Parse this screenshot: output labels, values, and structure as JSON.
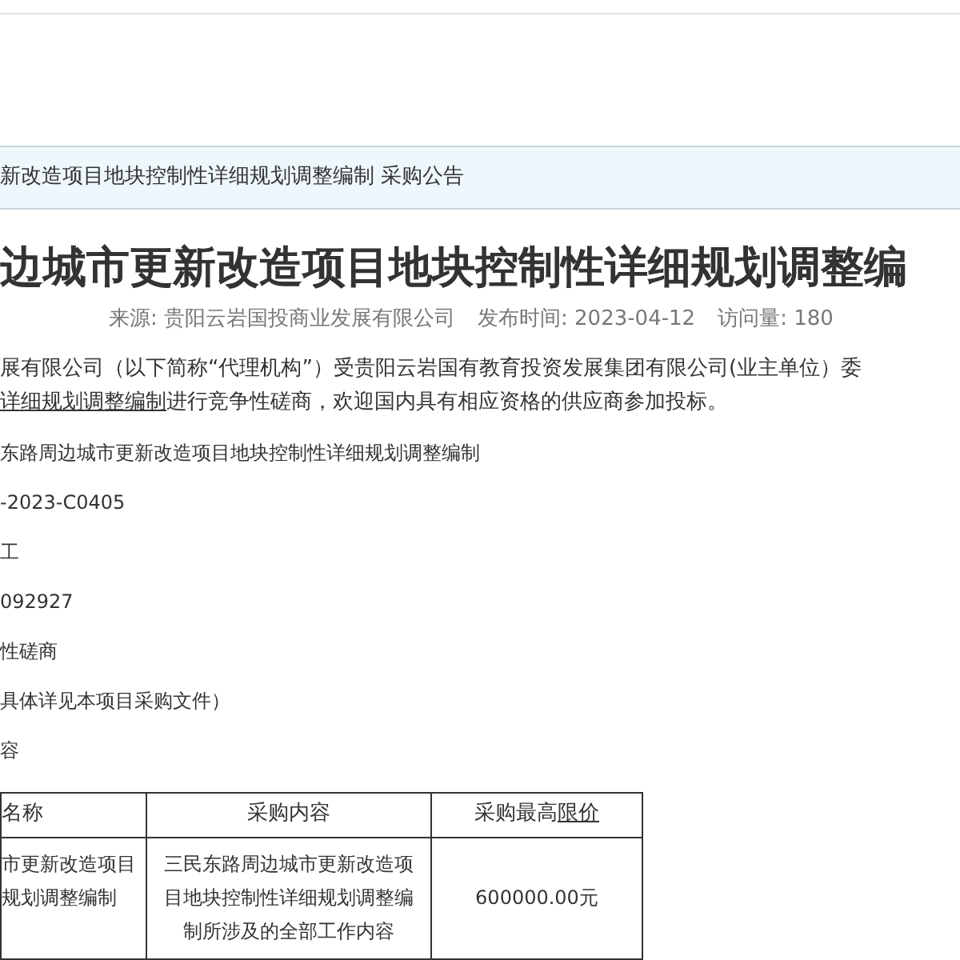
{
  "breadcrumb": "新改造项目地块控制性详细规划调整编制 采购公告",
  "title": "边城市更新改造项目地块控制性详细规划调整编",
  "meta": [
    "来源: 贵阳云岩国投商业发展有限公司",
    "发布时间: 2023-04-12",
    "访问量: 180"
  ],
  "paragraphs": [
    [
      {
        "text": "展有限公司（以下简称“代理机构”）受贵阳云岩国有教育投资发展集团有限公司(业主单位）委",
        "underlined": false
      }
    ],
    [
      {
        "text": "详细规划调整编制",
        "underlined": true
      },
      {
        "text": "进行竞争性磋商，欢迎国内具有相应资格的供应商参加投标。",
        "underlined": false
      }
    ]
  ],
  "lines": [
    "东路周边城市更新改造项目地块控制性详细规划调整编制",
    "-2023-C0405",
    "工",
    "092927",
    "性磋商",
    "具体详见本项目采购文件）",
    "容"
  ],
  "table": {
    "columns": [
      {
        "segments": [
          {
            "text": "名称",
            "underlined": false
          }
        ]
      },
      {
        "segments": [
          {
            "text": "采购内容",
            "underlined": false
          }
        ]
      },
      {
        "segments": [
          {
            "text": "采购最高",
            "underlined": false
          },
          {
            "text": "限价",
            "underlined": true
          }
        ]
      }
    ],
    "rows": [
      [
        "市更新改造项目规划调整编制",
        "三民东路周边城市更新改造项目地块控制性详细规划调整编制所涉及的全部工作内容",
        "600000.00元"
      ]
    ]
  }
}
